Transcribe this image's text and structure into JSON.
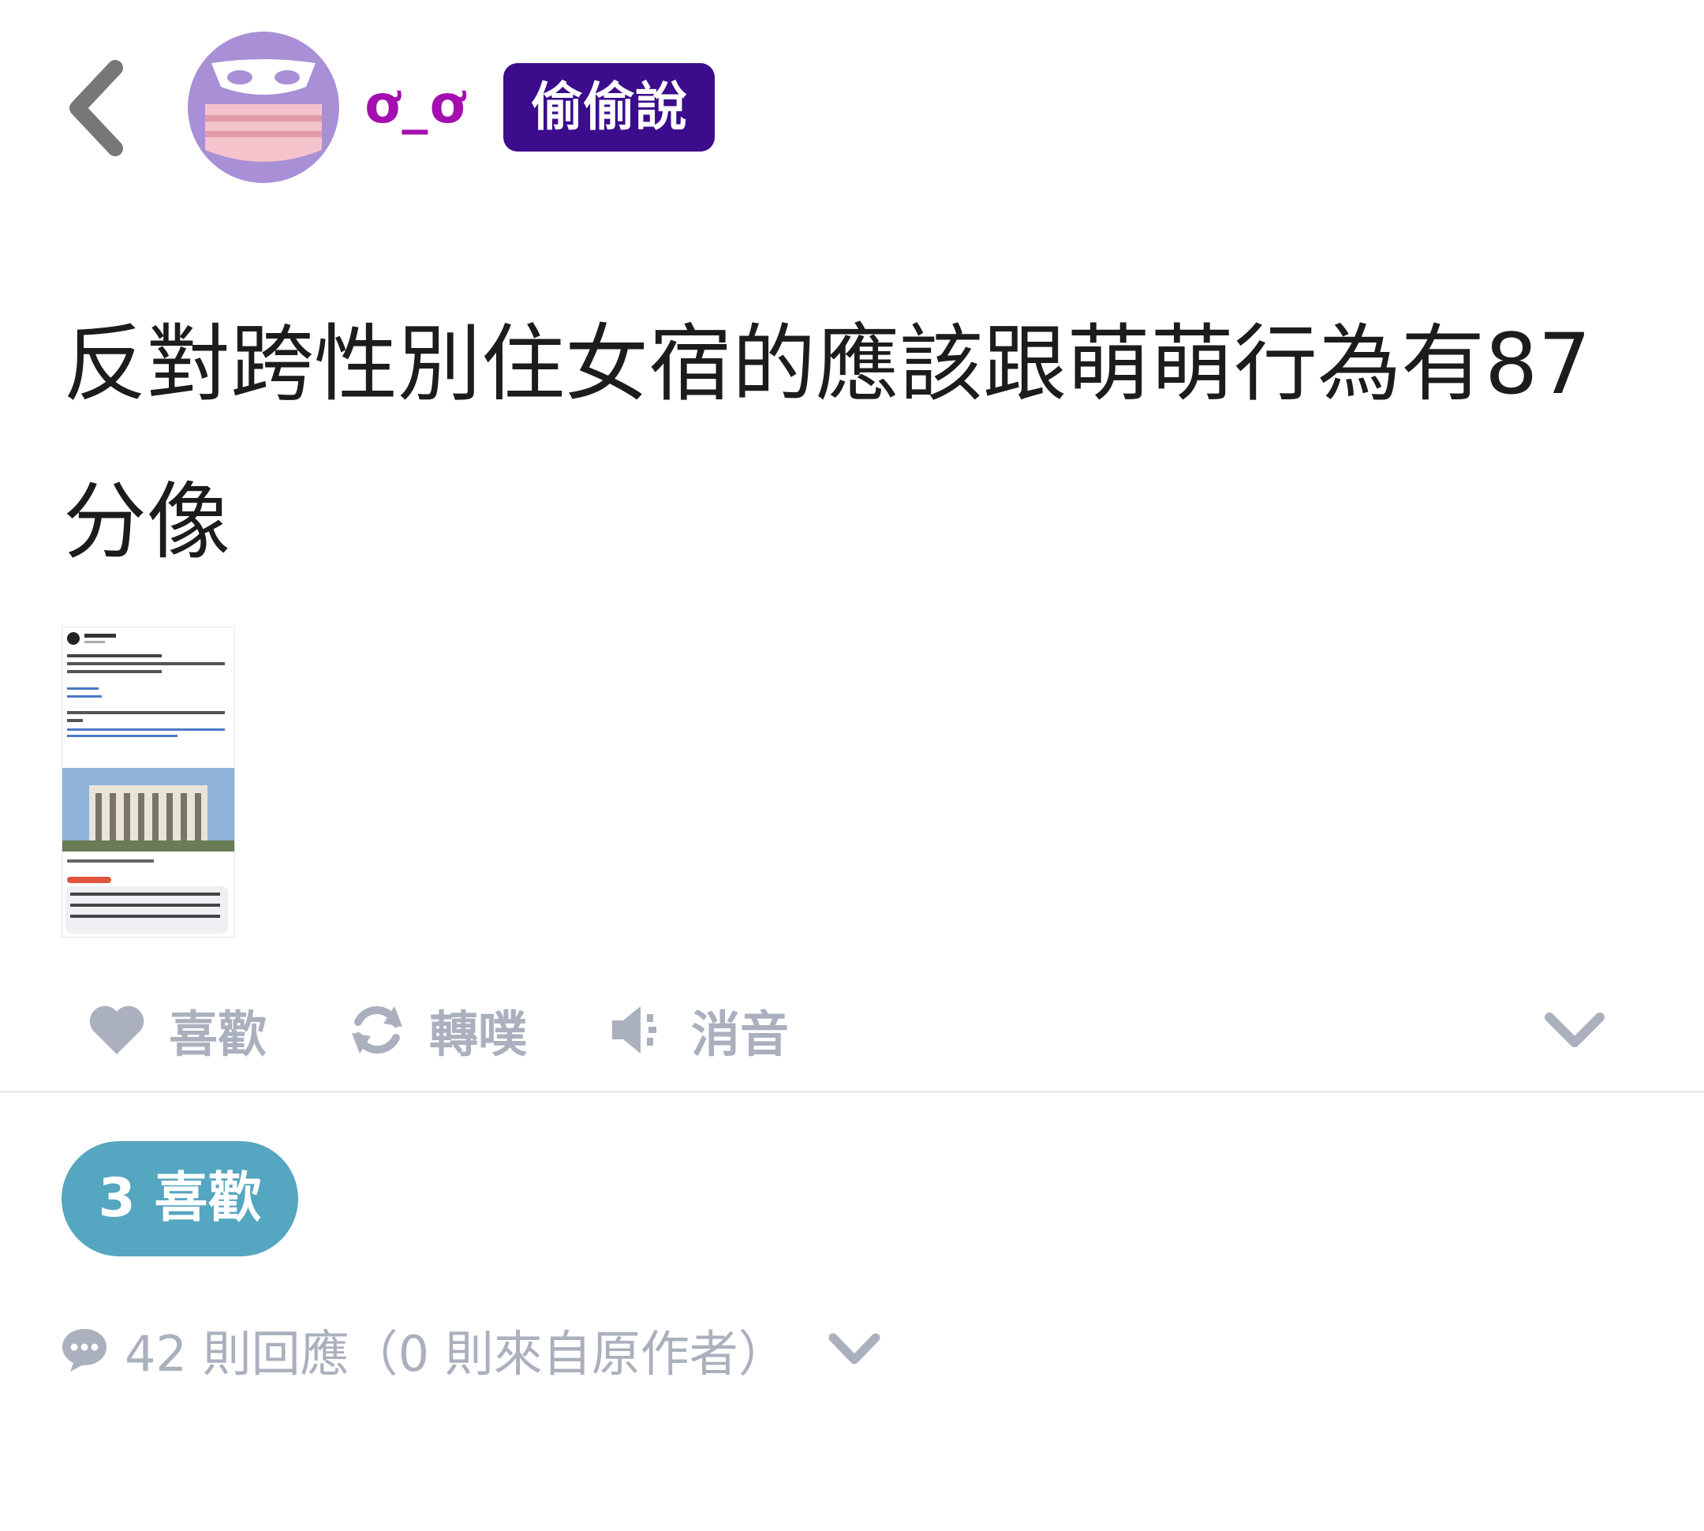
{
  "header": {
    "back_icon": "chevron-left-icon",
    "avatar_icon": "masked-owl-avatar",
    "author_name": "ơ_ơ",
    "tag": "偷偷說"
  },
  "post": {
    "content": "反對跨性別住女宿的應該跟萌萌行為有87分像",
    "attachment": {
      "kind": "screenshot-thumbnail",
      "visible_text": [
        "守護台灣",
        "【同人是男是女，小心被罰！】",
        "#性別議題",
        "#跨性別居住",
        "3小時",
        "讚",
        "回覆",
        "不要跟這樣的人爭執，身分證拿出來，身分證記載是男，就去住男生宿舍，身分證記載是女，就去住女生宿舍"
      ]
    }
  },
  "actions": [
    {
      "id": "like",
      "icon": "heart-icon",
      "label": "喜歡"
    },
    {
      "id": "replurk",
      "icon": "refresh-icon",
      "label": "轉噗"
    },
    {
      "id": "mute",
      "icon": "speaker-mute-icon",
      "label": "消音"
    },
    {
      "id": "more",
      "icon": "chevron-down-icon",
      "label": ""
    }
  ],
  "likes": {
    "label": "3 喜歡"
  },
  "replies": {
    "icon": "speech-bubble-icon",
    "label": "42 則回應（0 則來自原作者）",
    "expand_icon": "chevron-down-icon"
  },
  "colors": {
    "author": "#a40fb0",
    "tag_bg": "#3b0c8c",
    "likes_pill": "#55a6c0",
    "muted": "#aab0bd"
  }
}
